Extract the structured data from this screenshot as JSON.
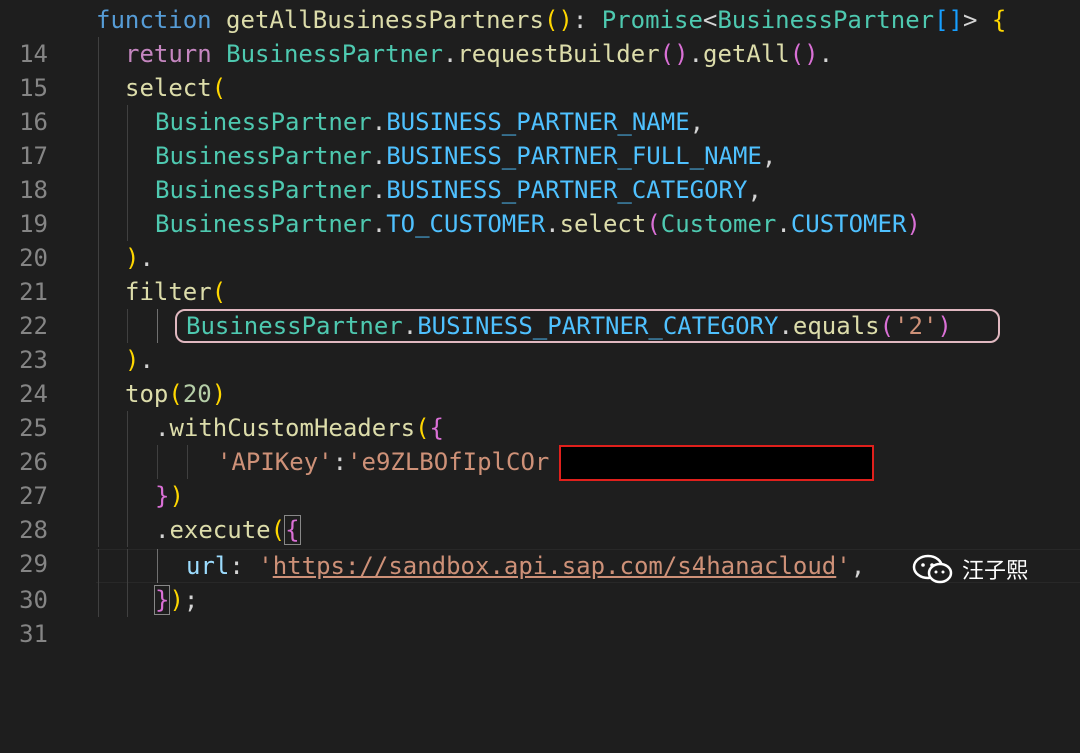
{
  "editor": {
    "line_numbers": [
      "14",
      "15",
      "16",
      "17",
      "18",
      "19",
      "20",
      "21",
      "22",
      "23",
      "24",
      "25",
      "26",
      "27",
      "28",
      "29",
      "30",
      "31"
    ],
    "lines": {
      "l14": {
        "kw": "function",
        "fn": "getAllBusinessPartners",
        "p1": "()",
        "colon": ": ",
        "cls": "Promise",
        "lt": "<",
        "cls2": "BusinessPartner",
        "arr": "[]",
        "gt": ">",
        "brace": " {"
      },
      "l15": {
        "kw": "return",
        "cls": "BusinessPartner",
        "dot": ".",
        "fn": "requestBuilder",
        "p": "()",
        "dot2": ".",
        "fn2": "getAll",
        "p2": "()",
        "dot3": "."
      },
      "l16": {
        "fn": "select",
        "paren": "("
      },
      "l17": {
        "cls": "BusinessPartner",
        "dot": ".",
        "prop": "BUSINESS_PARTNER_NAME",
        "comma": ","
      },
      "l18": {
        "cls": "BusinessPartner",
        "dot": ".",
        "prop": "BUSINESS_PARTNER_FULL_NAME",
        "comma": ","
      },
      "l19": {
        "cls": "BusinessPartner",
        "dot": ".",
        "prop": "BUSINESS_PARTNER_CATEGORY",
        "comma": ","
      },
      "l20": {
        "cls": "BusinessPartner",
        "dot": ".",
        "prop": "TO_CUSTOMER",
        "dot2": ".",
        "fn": "select",
        "p1": "(",
        "cls2": "Customer",
        "dot3": ".",
        "prop2": "CUSTOMER",
        "p2": ")"
      },
      "l21": {
        "paren": ")",
        "dot": "."
      },
      "l22": {
        "fn": "filter",
        "paren": "("
      },
      "l23": {
        "cls": "BusinessPartner",
        "dot": ".",
        "prop": "BUSINESS_PARTNER_CATEGORY",
        "dot2": ".",
        "fn": "equals",
        "p1": "(",
        "str": "'2'",
        "p2": ")"
      },
      "l24": {
        "paren": ")",
        "dot": "."
      },
      "l25": {
        "fn": "top",
        "p1": "(",
        "num": "20",
        "p2": ")"
      },
      "l26": {
        "dot": ".",
        "fn": "withCustomHeaders",
        "p1": "(",
        "brace": "{"
      },
      "l27": {
        "str1": "'APIKey'",
        "colon": ":",
        "str2": "'e9ZLBOfIplCOr"
      },
      "l28": {
        "brace": "}",
        "paren": ")"
      },
      "l29": {
        "dot": ".",
        "fn": "execute",
        "p1": "(",
        "brace": "{"
      },
      "l30": {
        "key": "url",
        "colon": ": ",
        "q1": "'",
        "url": "https://sandbox.api.sap.com/s4hanacloud",
        "q2": "'",
        "comma": ","
      },
      "l31": {
        "brace": "}",
        "paren": ")",
        "semi": ";"
      }
    }
  },
  "watermark": {
    "text": "汪子熙",
    "icon": "wechat-icon"
  }
}
